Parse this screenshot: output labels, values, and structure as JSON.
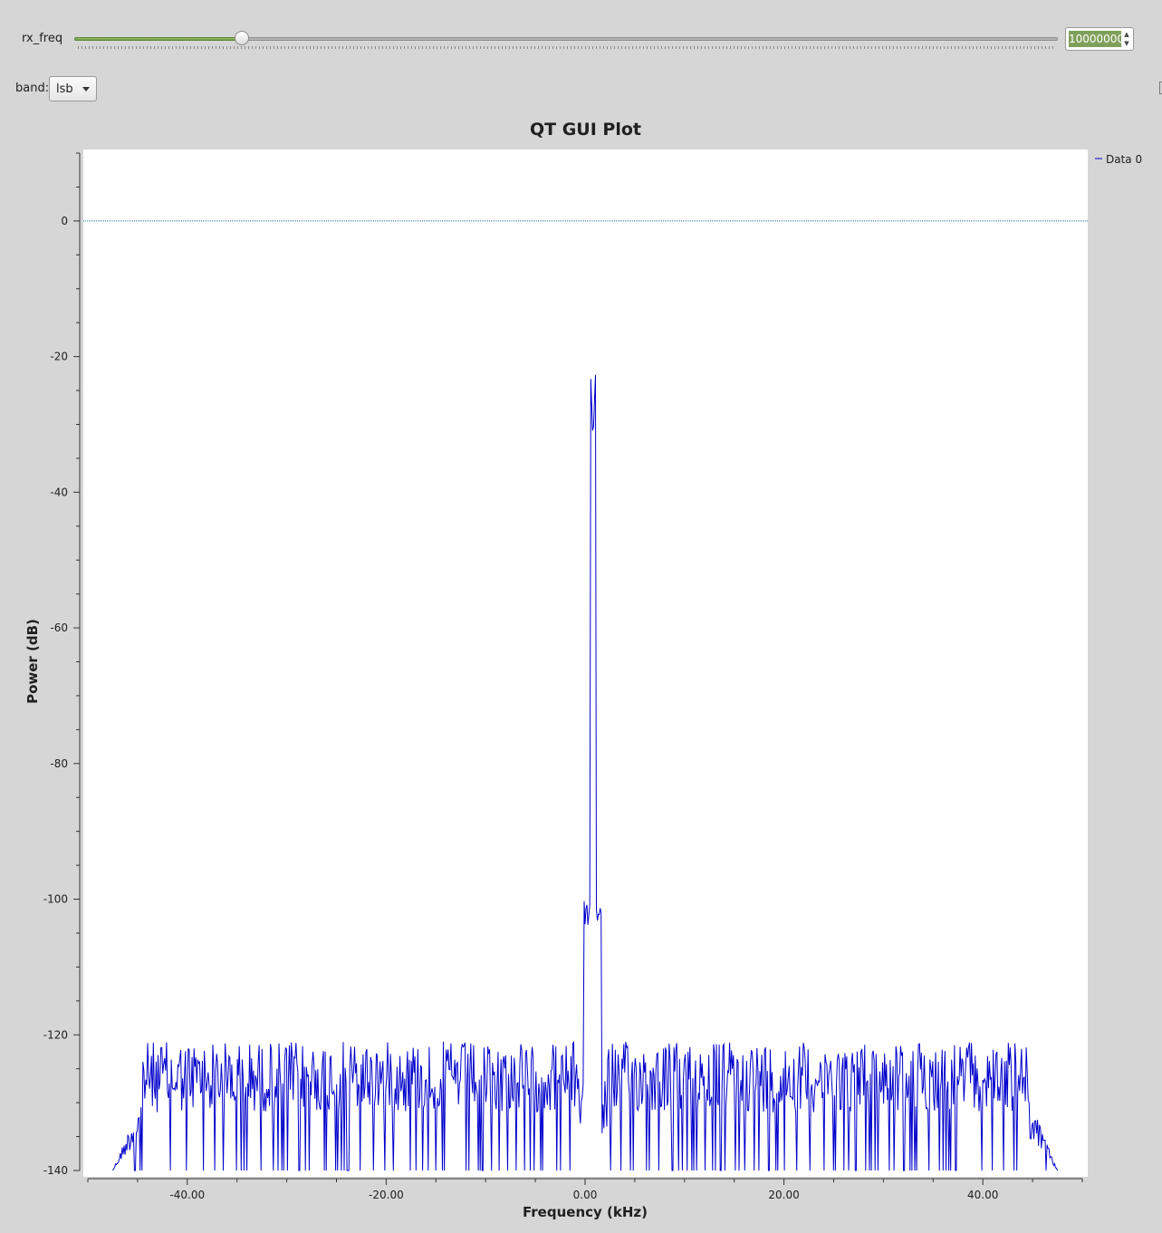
{
  "controls": {
    "rx_freq_label": "rx_freq",
    "rx_freq_value": "10000000",
    "rx_freq_slider_fraction": 0.17,
    "band_label": "band:",
    "band_value": "lsb"
  },
  "plot": {
    "title": "QT GUI Plot",
    "legend": "Data 0"
  },
  "colors": {
    "trace": "#0000cc",
    "reference_line": "#1a7a8a",
    "slider_fill": "#7fa05a"
  },
  "chart_data": {
    "type": "line",
    "title": "QT GUI Plot",
    "xlabel": "Frequency (kHz)",
    "ylabel": "Power (dB)",
    "xlim": [
      -50,
      50
    ],
    "ylim": [
      -140,
      10
    ],
    "x_ticks": [
      -40,
      -20,
      0,
      20,
      40
    ],
    "x_tick_labels": [
      "-40.00",
      "-20.00",
      "0.00",
      "20.00",
      "40.00"
    ],
    "y_ticks": [
      0,
      -20,
      -40,
      -60,
      -80,
      -100,
      -120,
      -140
    ],
    "y_tick_labels": [
      "0",
      "-20",
      "-40",
      "-60",
      "-80",
      "-100",
      "-120",
      "-140"
    ],
    "grid": false,
    "legend_position": "top-right",
    "reference_line_y": 0,
    "series": [
      {
        "name": "Data 0",
        "noise_range_khz": [
          -47.5,
          47.5
        ],
        "noise_floor_db": [
          -140,
          -121
        ],
        "peak": {
          "x": 0.8,
          "y": -32.5
        },
        "peak_shoulder_db": -100
      }
    ]
  }
}
